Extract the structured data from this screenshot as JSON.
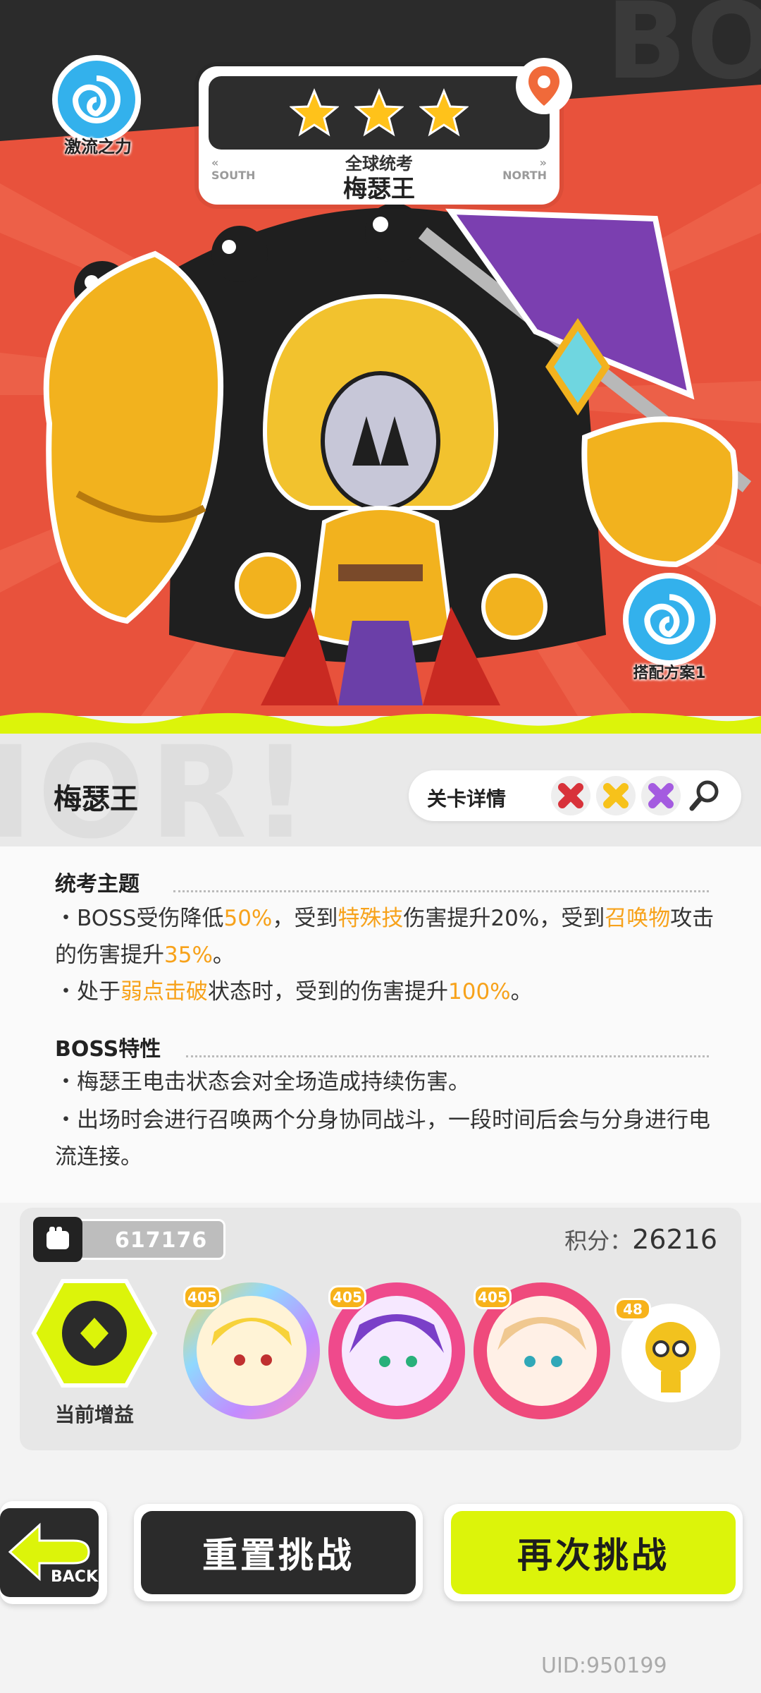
{
  "hero": {
    "element_label": "激流之力",
    "plan_label": "搭配方案1",
    "location": {
      "stars": 3,
      "subtitle": "全球统考",
      "name": "梅瑟王",
      "south": "SOUTH",
      "north": "NORTH"
    }
  },
  "header": {
    "title": "梅瑟王",
    "detail_label": "关卡详情"
  },
  "sections": {
    "theme": {
      "title": "统考主题",
      "lines": [
        [
          {
            "t": "・BOSS受伤降低",
            "h": false
          },
          {
            "t": "50%",
            "h": true
          },
          {
            "t": "，受到",
            "h": false
          },
          {
            "t": "特殊技",
            "h": true
          },
          {
            "t": "伤害提升20%，受到",
            "h": false
          },
          {
            "t": "召唤物",
            "h": true
          },
          {
            "t": "攻击的伤害提升",
            "h": false
          },
          {
            "t": "35%",
            "h": true
          },
          {
            "t": "。",
            "h": false
          }
        ],
        [
          {
            "t": "・处于",
            "h": false
          },
          {
            "t": "弱点击破",
            "h": true
          },
          {
            "t": "状态时，受到的伤害提升",
            "h": false
          },
          {
            "t": "100%",
            "h": true
          },
          {
            "t": "。",
            "h": false
          }
        ]
      ]
    },
    "boss": {
      "title": "BOSS特性",
      "lines": [
        "・梅瑟王电击状态会对全场造成持续伤害。",
        "・出场时会进行召唤两个分身协同战斗，一段时间后会与分身进行电流连接。"
      ]
    }
  },
  "team": {
    "power": "617176",
    "score_label": "积分：",
    "score": "26216",
    "buff_label": "当前增益",
    "heroes": [
      {
        "level": "405"
      },
      {
        "level": "405"
      },
      {
        "level": "405"
      }
    ],
    "pet_level": "48"
  },
  "buttons": {
    "back": "BACK",
    "reset": "重置挑战",
    "again": "再次挑战"
  },
  "uid": "UID:950199",
  "colors": {
    "accent_yellow": "#dcf40a",
    "highlight": "#f7a21b",
    "hero_bg": "#e8523c"
  }
}
